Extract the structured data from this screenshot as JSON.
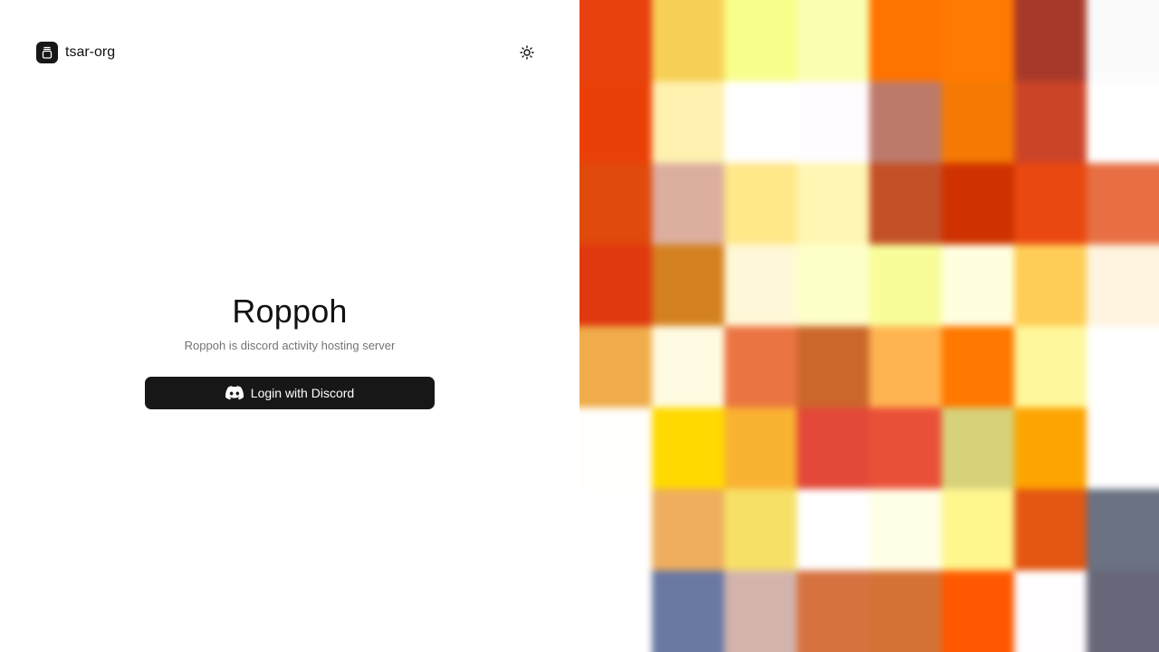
{
  "brand": {
    "name": "tsar-org",
    "icon": "jar-icon"
  },
  "theme_toggle": {
    "icon": "sun-icon"
  },
  "hero": {
    "title": "Roppoh",
    "subtitle": "Roppoh is discord activity hosting server"
  },
  "login": {
    "label": "Login with Discord",
    "icon": "discord-icon"
  },
  "colors": {
    "button_bg": "#171717",
    "subtitle": "#737373",
    "mosaic": [
      [
        "#e8400e",
        "#f6d056",
        "#f8fe8a",
        "#fafeb0",
        "#ff7300",
        "#ff7a00",
        "#a8392a",
        "#fbfbfc"
      ],
      [
        "#ea4008",
        "#fff1b0",
        "#ffffff",
        "#fffcff",
        "#bd7a6b",
        "#f47a04",
        "#cc4428",
        "#ffffff"
      ],
      [
        "#e04a0a",
        "#dcae9e",
        "#ffe888",
        "#fff6b3",
        "#c35127",
        "#cf3200",
        "#ea4810",
        "#e76f43"
      ],
      [
        "#e0380f",
        "#d48121",
        "#fff8d8",
        "#fdffc8",
        "#f8fd9a",
        "#ffffe0",
        "#ffcd56",
        "#fff4e0"
      ],
      [
        "#f0ac4a",
        "#fffbe2",
        "#eb7542",
        "#cb672b",
        "#ffb451",
        "#ff7800",
        "#fff79b",
        "#ffffff"
      ],
      [
        "#fffefa",
        "#ffd900",
        "#fab232",
        "#e34838",
        "#ea5038",
        "#d6d27a",
        "#fda400",
        "#ffffff"
      ],
      [
        "#ffffff",
        "#eeae5e",
        "#f7e066",
        "#ffffff",
        "#ffffe8",
        "#fff68e",
        "#e35712",
        "#6b7283"
      ],
      [
        "#ffffff",
        "#6a78a4",
        "#d3b4ac",
        "#d67240",
        "#d47236",
        "#ff5800",
        "#fffdff",
        "#676779"
      ]
    ]
  }
}
